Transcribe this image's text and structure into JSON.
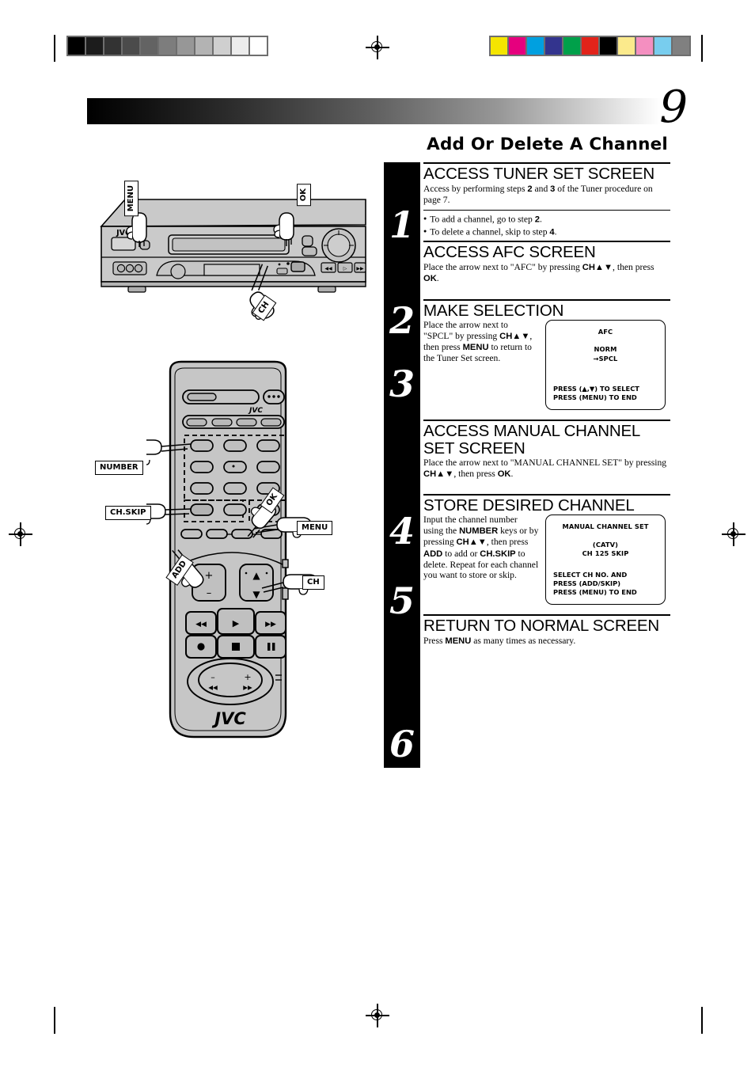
{
  "page": {
    "number": "9",
    "section_title": "Add Or Delete A Channel"
  },
  "print_marks": {
    "gray_swatches": [
      "#000000",
      "#1c1c1c",
      "#333333",
      "#4b4b4b",
      "#636363",
      "#7d7d7d",
      "#979797",
      "#b3b3b3",
      "#cfcfcf",
      "#ececec",
      "#ffffff"
    ],
    "color_swatches": [
      "#f5e500",
      "#e6007e",
      "#00a0e0",
      "#33348e",
      "#00a04a",
      "#e2231a",
      "#000000",
      "#fbea8c",
      "#f48fc0",
      "#78cdee",
      "#808080"
    ]
  },
  "steps": [
    {
      "number": "1",
      "title": "ACCESS TUNER SET SCREEN",
      "body_parts": [
        {
          "t": "Access by performing steps "
        },
        {
          "t": "2",
          "b": true
        },
        {
          "t": " and "
        },
        {
          "t": "3",
          "b": true
        },
        {
          "t": " of the Tuner procedure on page 7."
        }
      ],
      "bullets": [
        [
          {
            "t": "To add a channel, go to step "
          },
          {
            "t": "2",
            "b": true
          },
          {
            "t": "."
          }
        ],
        [
          {
            "t": "To delete a channel, skip to step "
          },
          {
            "t": "4",
            "b": true
          },
          {
            "t": "."
          }
        ]
      ]
    },
    {
      "number": "2",
      "title": "ACCESS AFC SCREEN",
      "body_parts": [
        {
          "t": "Place the arrow next to \"AFC\" by pressing "
        },
        {
          "t": "CH▲▼",
          "b": true
        },
        {
          "t": ", then press "
        },
        {
          "t": "OK",
          "b": true
        },
        {
          "t": "."
        }
      ]
    },
    {
      "number": "3",
      "title": "MAKE SELECTION",
      "body_parts": [
        {
          "t": "Place the arrow next to \"SPCL\" by pressing "
        },
        {
          "t": "CH▲▼",
          "b": true
        },
        {
          "t": ", then press "
        },
        {
          "t": "MENU",
          "b": true
        },
        {
          "t": " to return to the Tuner Set screen."
        }
      ],
      "osd": {
        "title": "AFC",
        "line1": "NORM",
        "line2": "→SPCL",
        "footer1": "PRESS (▲,▼) TO SELECT",
        "footer2": "PRESS (MENU) TO END"
      }
    },
    {
      "number": "4",
      "title": "ACCESS MANUAL CHANNEL SET SCREEN",
      "body_parts": [
        {
          "t": "Place the arrow next to \"MANUAL CHANNEL SET\" by pressing "
        },
        {
          "t": "CH▲▼",
          "b": true
        },
        {
          "t": ", then press "
        },
        {
          "t": "OK",
          "b": true
        },
        {
          "t": "."
        }
      ]
    },
    {
      "number": "5",
      "title": "STORE DESIRED CHANNEL",
      "body_parts": [
        {
          "t": "Input the channel number using the "
        },
        {
          "t": "NUMBER",
          "b": true
        },
        {
          "t": " keys or by pressing "
        },
        {
          "t": "CH▲▼",
          "b": true
        },
        {
          "t": ", then press "
        },
        {
          "t": "ADD",
          "b": true
        },
        {
          "t": " to add or "
        },
        {
          "t": "CH.SKIP",
          "b": true
        },
        {
          "t": " to delete. Repeat for each channel you want to store or skip."
        }
      ],
      "osd": {
        "title": "MANUAL CHANNEL SET",
        "line1": "(CATV)",
        "line2": "CH  125  SKIP",
        "footer1": "SELECT CH NO. AND",
        "footer2": "PRESS (ADD/SKIP)",
        "footer3": "PRESS (MENU) TO END"
      }
    },
    {
      "number": "6",
      "title": "RETURN TO NORMAL SCREEN",
      "body_parts": [
        {
          "t": "Press "
        },
        {
          "t": "MENU",
          "b": true
        },
        {
          "t": " as many times as necessary."
        }
      ]
    }
  ],
  "vcr_figure": {
    "brand": "JVC",
    "callouts": [
      "MENU",
      "OK",
      "CH"
    ]
  },
  "remote_figure": {
    "brand": "JVC",
    "callouts": [
      "NUMBER",
      "CH.SKIP",
      "OK",
      "MENU",
      "ADD",
      "CH"
    ]
  }
}
